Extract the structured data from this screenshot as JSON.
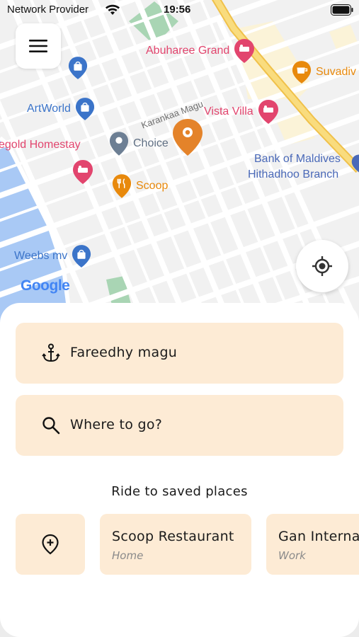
{
  "status_bar": {
    "carrier": "Network Provider",
    "time": "19:56"
  },
  "map": {
    "pois": [
      {
        "name": "Abuharee Grand",
        "kind": "hotel",
        "color": "#e2456e"
      },
      {
        "name": "Suvadiv",
        "kind": "cafe",
        "color": "#e8890c"
      },
      {
        "name": "ArtWorld",
        "kind": "shopping",
        "color": "#3b74c9"
      },
      {
        "name": "Vista Villa",
        "kind": "hotel",
        "color": "#e2456e"
      },
      {
        "name": "Choice",
        "kind": "place",
        "color": "#5f6f83"
      },
      {
        "name": "egold Homestay",
        "kind": "hotel",
        "color": "#e2456e"
      },
      {
        "name": "Bank of Maldives",
        "kind": "bank",
        "color": "#4a69b8"
      },
      {
        "name": "Hithadhoo Branch",
        "kind": "bank",
        "color": "#4a69b8"
      },
      {
        "name": "Scoop",
        "kind": "restaurant",
        "color": "#e8890c"
      },
      {
        "name": "Weebs mv",
        "kind": "shopping",
        "color": "#3b74c9"
      }
    ],
    "road_label": "Karankaa Magu",
    "attribution": "Google",
    "selected_marker_color": "#e4832a"
  },
  "sheet": {
    "from_location": "Fareedhy magu",
    "destination_placeholder": "Where to go?",
    "saved_title": "Ride to saved places",
    "saved_places": [
      {
        "name": "Scoop Restaurant",
        "type": "Home"
      },
      {
        "name": "Gan International",
        "type": "Work"
      }
    ]
  },
  "colors": {
    "field_background": "#fdebd5",
    "sheet_background": "#ffffff"
  }
}
